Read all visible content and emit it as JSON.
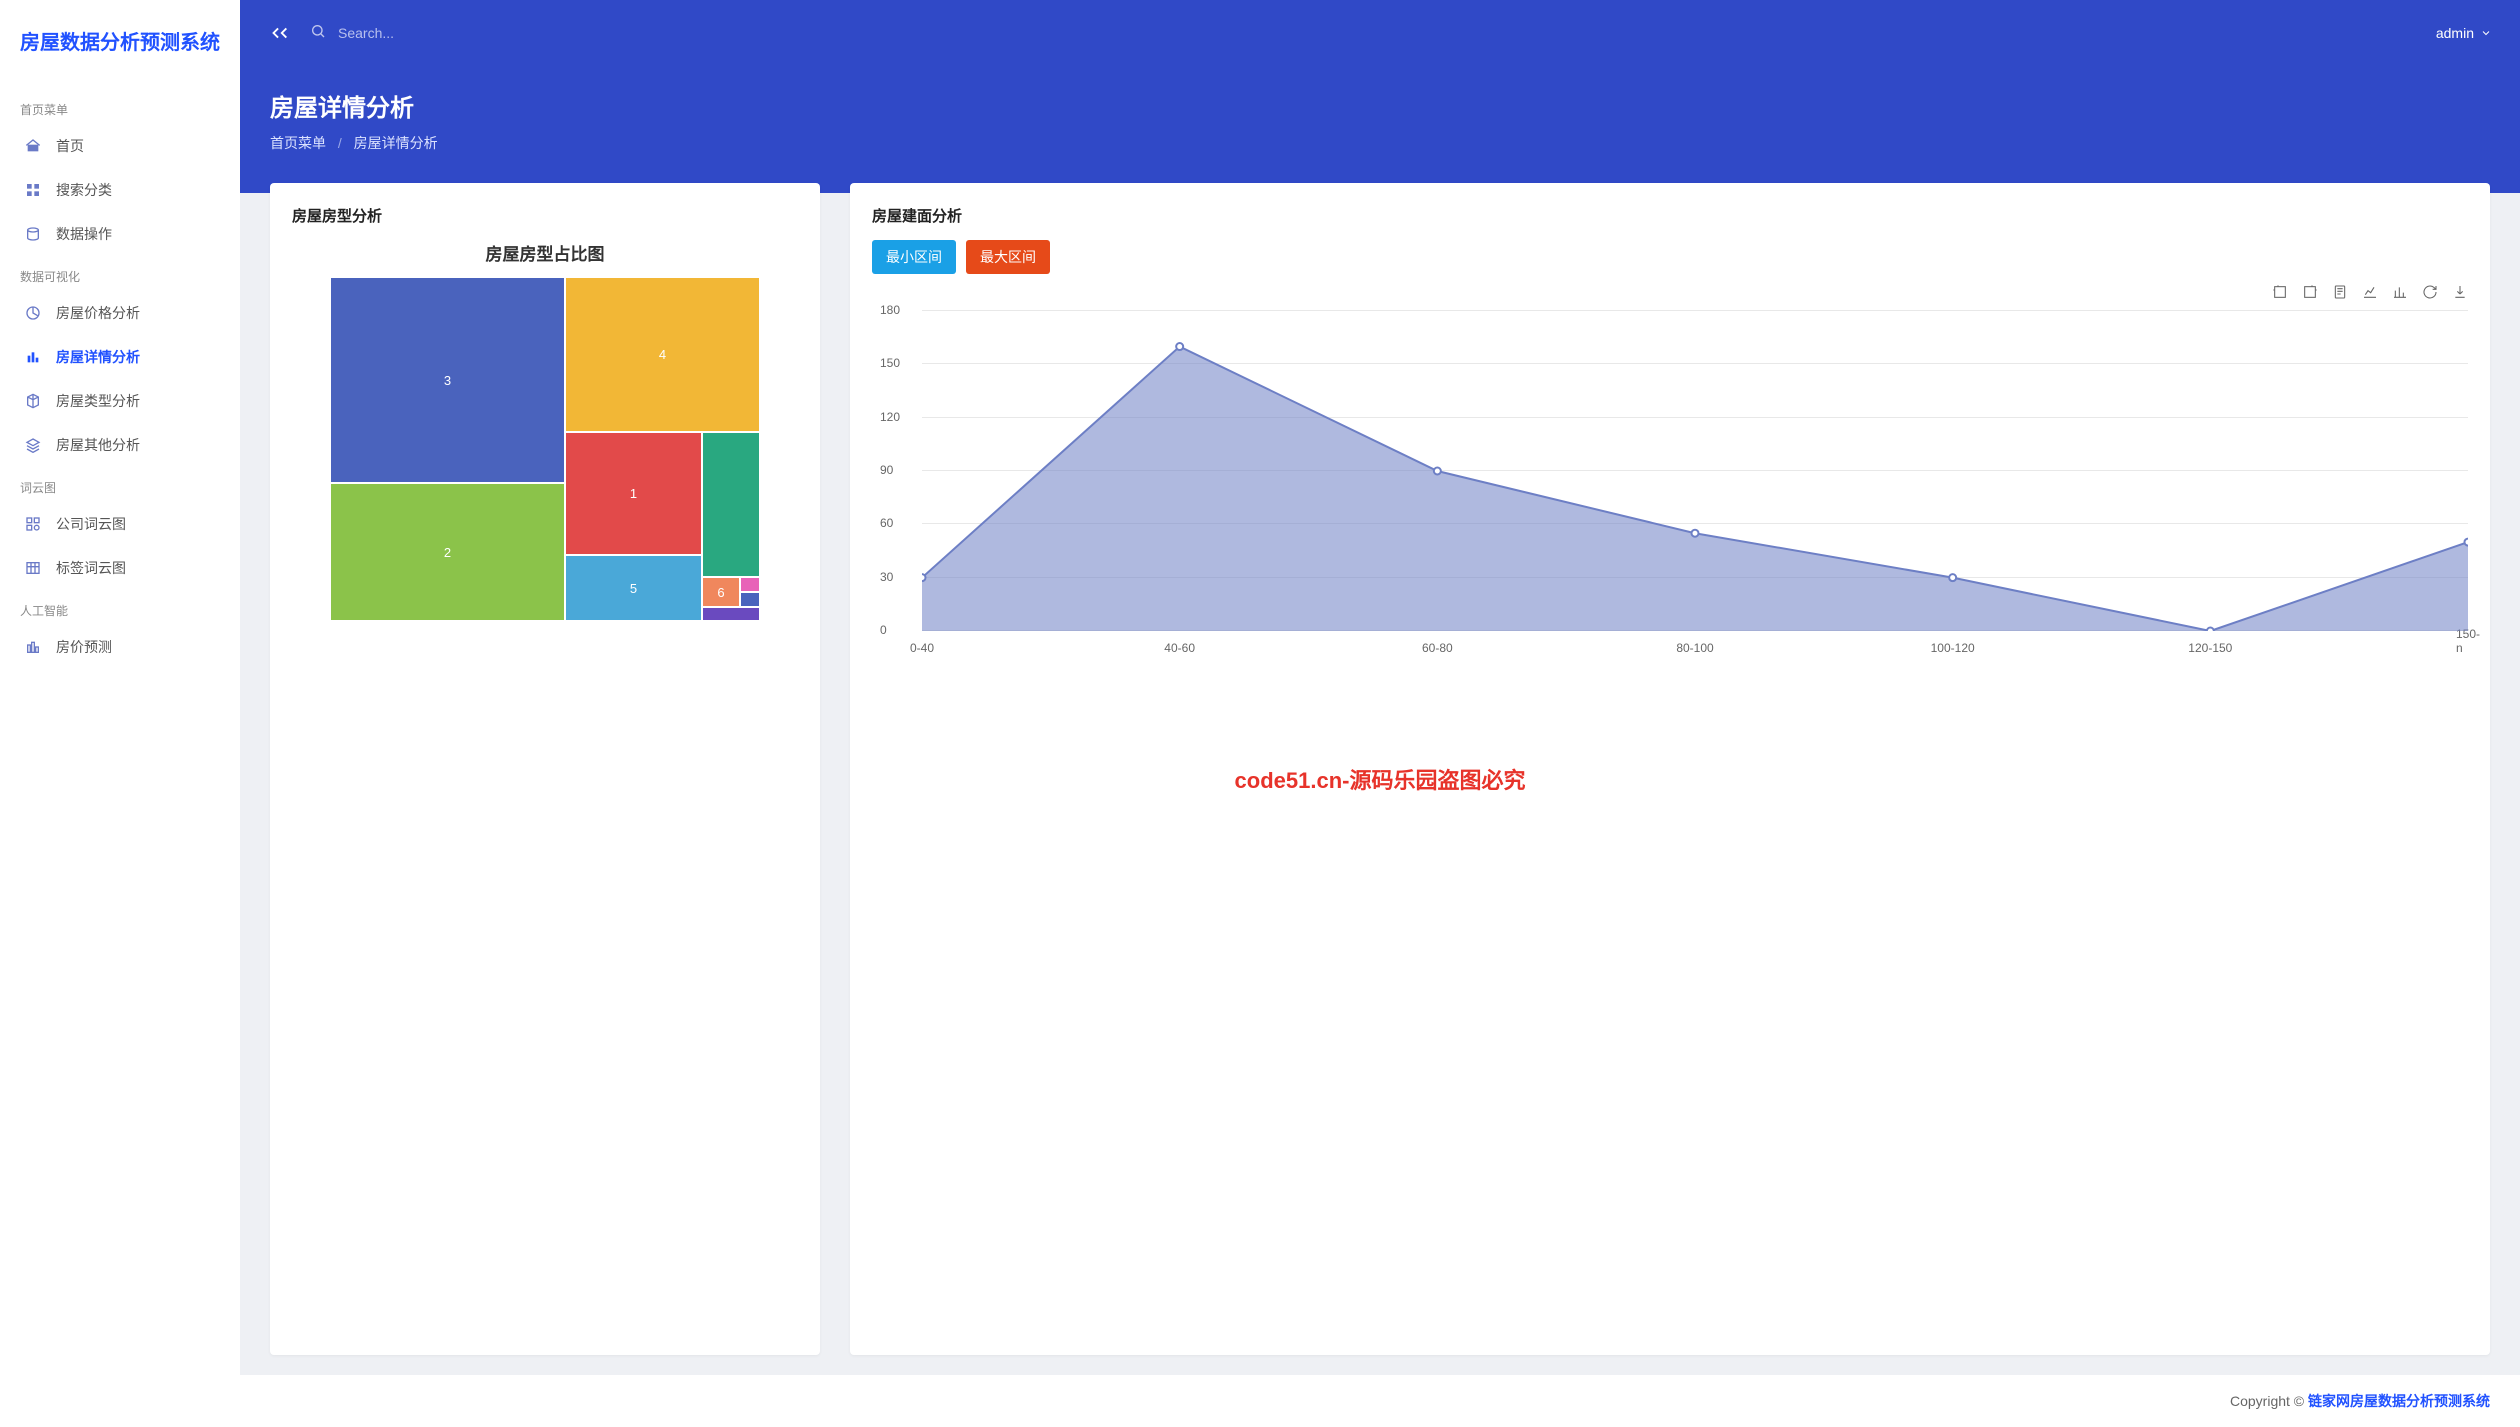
{
  "app_title": "房屋数据分析预测系统",
  "search_placeholder": "Search...",
  "user_name": "admin",
  "page": {
    "title": "房屋详情分析",
    "crumb_root": "首页菜单",
    "crumb_leaf": "房屋详情分析"
  },
  "sidebar": {
    "groups": [
      {
        "label": "首页菜单",
        "items": [
          {
            "icon": "home",
            "label": "首页"
          },
          {
            "icon": "grid",
            "label": "搜索分类"
          },
          {
            "icon": "db",
            "label": "数据操作"
          }
        ]
      },
      {
        "label": "数据可视化",
        "items": [
          {
            "icon": "pie",
            "label": "房屋价格分析"
          },
          {
            "icon": "bars",
            "label": "房屋详情分析",
            "active": true
          },
          {
            "icon": "cube",
            "label": "房屋类型分析"
          },
          {
            "icon": "layers",
            "label": "房屋其他分析"
          }
        ]
      },
      {
        "label": "词云图",
        "items": [
          {
            "icon": "tag",
            "label": "公司词云图"
          },
          {
            "icon": "table",
            "label": "标签词云图"
          }
        ]
      },
      {
        "label": "人工智能",
        "items": [
          {
            "icon": "ai",
            "label": "房价预测"
          }
        ]
      }
    ]
  },
  "card_left": {
    "title": "房屋房型分析",
    "subtitle": "房屋房型占比图"
  },
  "card_right": {
    "title": "房屋建面分析",
    "btn_min": "最小区间",
    "btn_max": "最大区间"
  },
  "footer": {
    "prefix": "Copyright © ",
    "link": "链家网房屋数据分析预测系统"
  },
  "watermark": "code51.cn-源码乐园盗图必究",
  "chart_data": [
    {
      "type": "treemap",
      "title": "房屋房型占比图",
      "items": [
        {
          "label": "3",
          "value": 120,
          "color": "#4a63bd"
        },
        {
          "label": "2",
          "value": 80,
          "color": "#8bc34a"
        },
        {
          "label": "4",
          "value": 60,
          "color": "#f2b736"
        },
        {
          "label": "1",
          "value": 40,
          "color": "#e24a4a"
        },
        {
          "label": "5",
          "value": 28,
          "color": "#4aa8d8"
        },
        {
          "label": "",
          "value": 22,
          "color": "#29a880"
        },
        {
          "label": "6",
          "value": 8,
          "color": "#f0875d"
        },
        {
          "label": "",
          "value": 3,
          "color": "#e863b8"
        },
        {
          "label": "",
          "value": 3,
          "color": "#4a63bd"
        },
        {
          "label": "",
          "value": 3,
          "color": "#6a4abf"
        }
      ]
    },
    {
      "type": "area",
      "title": "房屋建面分析",
      "categories": [
        "0-40",
        "40-60",
        "60-80",
        "80-100",
        "100-120",
        "120-150",
        "150-n"
      ],
      "values": [
        30,
        160,
        90,
        55,
        30,
        0,
        50
      ],
      "ylim": [
        0,
        180
      ],
      "ytick": 30,
      "color": "#6d7fc5"
    }
  ]
}
